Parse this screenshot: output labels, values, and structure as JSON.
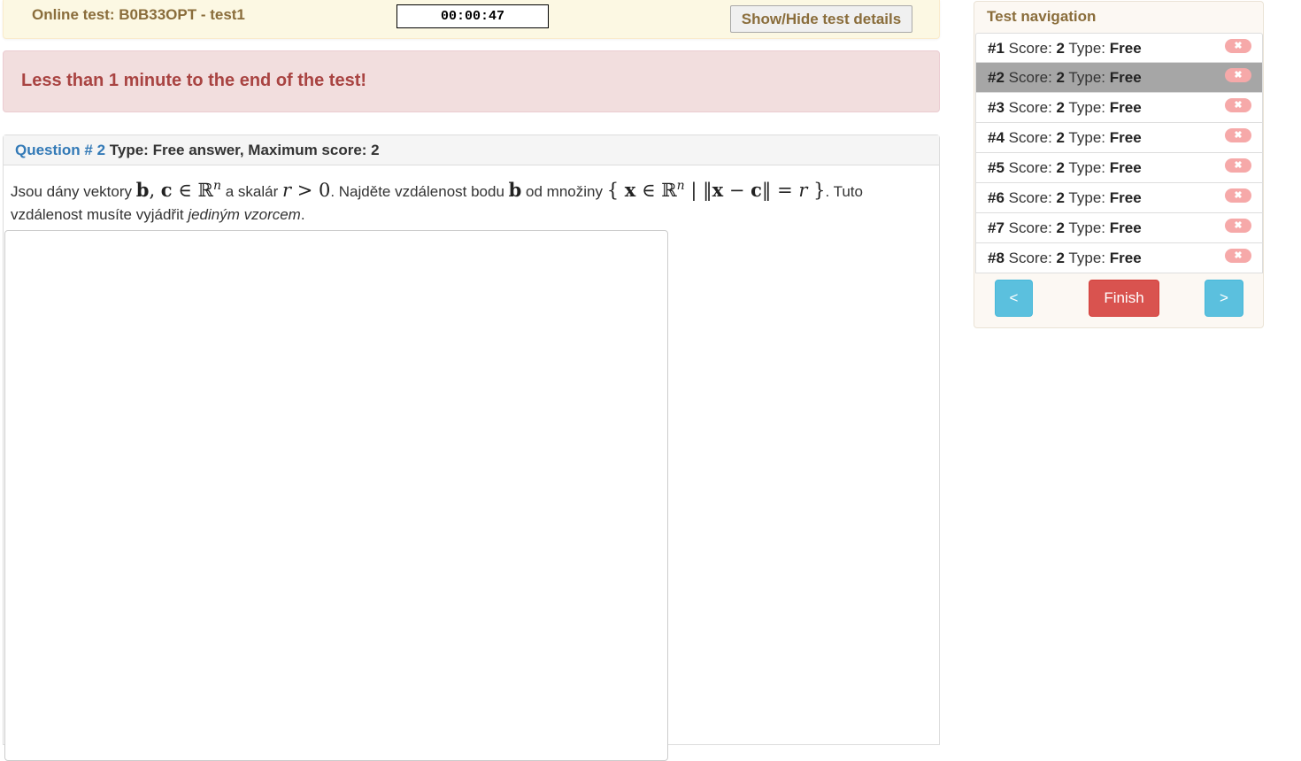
{
  "header": {
    "title": "Online test: B0B33OPT - test1",
    "timer": "00:00:47",
    "details_button": "Show/Hide test details"
  },
  "warning": {
    "text": "Less than 1 minute to the end of the test!"
  },
  "question": {
    "number_label": "Question # 2",
    "meta": "Type: Free answer, Maximum score: 2",
    "text_1": "Jsou dány vektory ",
    "math_1_b": "b",
    "math_1_sep": ", ",
    "math_1_c": "c",
    "math_1_rest": " ∈ ℝ",
    "math_1_sup": "n",
    "text_2": " a skalár ",
    "math_2_r": "r",
    "math_2_rest": " > 0",
    "text_3": ". Najděte vzdálenost bodu ",
    "math_3_b": "b",
    "text_4": " od množiny ",
    "math_4_open": "{ ",
    "math_4_x": "x",
    "math_4_in": " ∈ ℝ",
    "math_4_sup": "n",
    "math_4_bar": " | ‖",
    "math_4_x2": "x",
    "math_4_minus": " − ",
    "math_4_c": "c",
    "math_4_eq": "‖ = ",
    "math_4_r": "r",
    "math_4_close": " }",
    "text_5": ". Tuto vzdálenost musíte vyjádřit ",
    "text_italic": "jediným vzorcem",
    "text_6": ".",
    "answer_value": ""
  },
  "navigation": {
    "heading": "Test navigation",
    "score_label": "Score:",
    "type_label": "Type:",
    "items": [
      {
        "id": "#1",
        "score": "2",
        "type": "Free"
      },
      {
        "id": "#2",
        "score": "2",
        "type": "Free"
      },
      {
        "id": "#3",
        "score": "2",
        "type": "Free"
      },
      {
        "id": "#4",
        "score": "2",
        "type": "Free"
      },
      {
        "id": "#5",
        "score": "2",
        "type": "Free"
      },
      {
        "id": "#6",
        "score": "2",
        "type": "Free"
      },
      {
        "id": "#7",
        "score": "2",
        "type": "Free"
      },
      {
        "id": "#8",
        "score": "2",
        "type": "Free"
      }
    ],
    "active_index": 1,
    "status_icon": "close-icon",
    "status_glyph": "✖",
    "prev_label": "<",
    "finish_label": "Finish",
    "next_label": ">"
  },
  "colors": {
    "header_bg": "#fcf8e3",
    "header_text": "#8a6d3b",
    "warning_bg": "#f2dede",
    "warning_text": "#a94442",
    "link_blue": "#337ab7",
    "active_row": "#a6a6a6",
    "nav_button": "#5bc0de",
    "finish_button": "#d9534f",
    "badge": "#f6a9a9"
  }
}
